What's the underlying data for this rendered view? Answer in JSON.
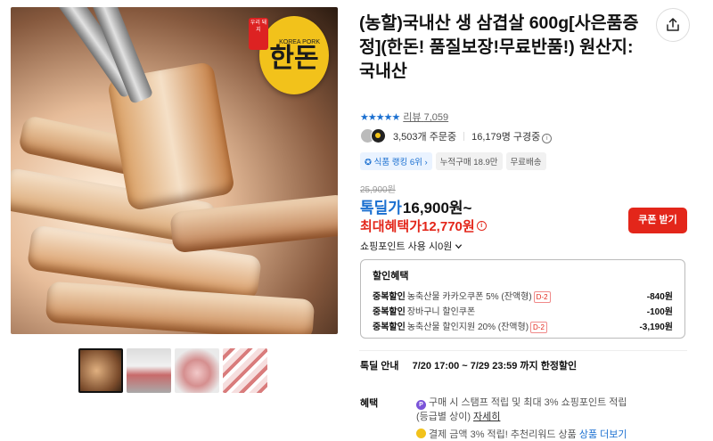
{
  "product": {
    "title": "(농할)국내산 생 삼겹살 600g[사은품증정](한돈! 품질보장!무료반품!) 원산지: 국내산",
    "brand_badge_text": "한돈",
    "brand_badge_small": "KOREA PORK",
    "seal_text": "우리 돼지",
    "rating": {
      "stars": 4.5,
      "review_label": "리뷰",
      "review_count": "7,059"
    },
    "stats": {
      "orders": "3,503개 주문중",
      "subscribers": "16,179명 구경중"
    },
    "badges": [
      "식품 랭킹 6위",
      "누적구매 18.9만",
      "무료배송"
    ],
    "original_price": "25,900원",
    "price_label": "톡딜가",
    "price": "16,900원~",
    "max_benefit": "최대혜택가12,770원",
    "coupon_button": "쿠폰 받기",
    "points": "쇼핑포인트 사용 시0원"
  },
  "discounts": {
    "title": "할인혜택",
    "rows": [
      {
        "label": "중복할인",
        "desc": "농축산물 카카오쿠폰 5% (잔액형)",
        "tag": "D-2",
        "amount": "-840원"
      },
      {
        "label": "중복할인",
        "desc": "장바구니 할인쿠폰",
        "tag": "",
        "amount": "-100원"
      },
      {
        "label": "중복할인",
        "desc": "농축산물 할인지원 20% (잔액형)",
        "tag": "D-2",
        "amount": "-3,190원"
      }
    ]
  },
  "delivery": {
    "label": "톡딜 안내",
    "text": "7/20 17:00 ~ 7/29 23:59 까지 한정할인"
  },
  "benefits": {
    "label": "혜택",
    "line1": "구매 시 스탬프 적립 및 최대 3% 쇼핑포인트 적립",
    "line1b": "(등급별 상이)",
    "line1_link": "자세히",
    "line2": "결제 금액 3% 적립! 추천리워드 상품",
    "line2_link": "상품 더보기"
  },
  "colors": {
    "accent_blue": "#1a6fd0",
    "accent_red": "#e3261a",
    "badge_yellow": "#f2c21b"
  },
  "icons": {
    "share": "share-icon",
    "info": "info-icon",
    "chevron": "chevron-down-icon"
  }
}
